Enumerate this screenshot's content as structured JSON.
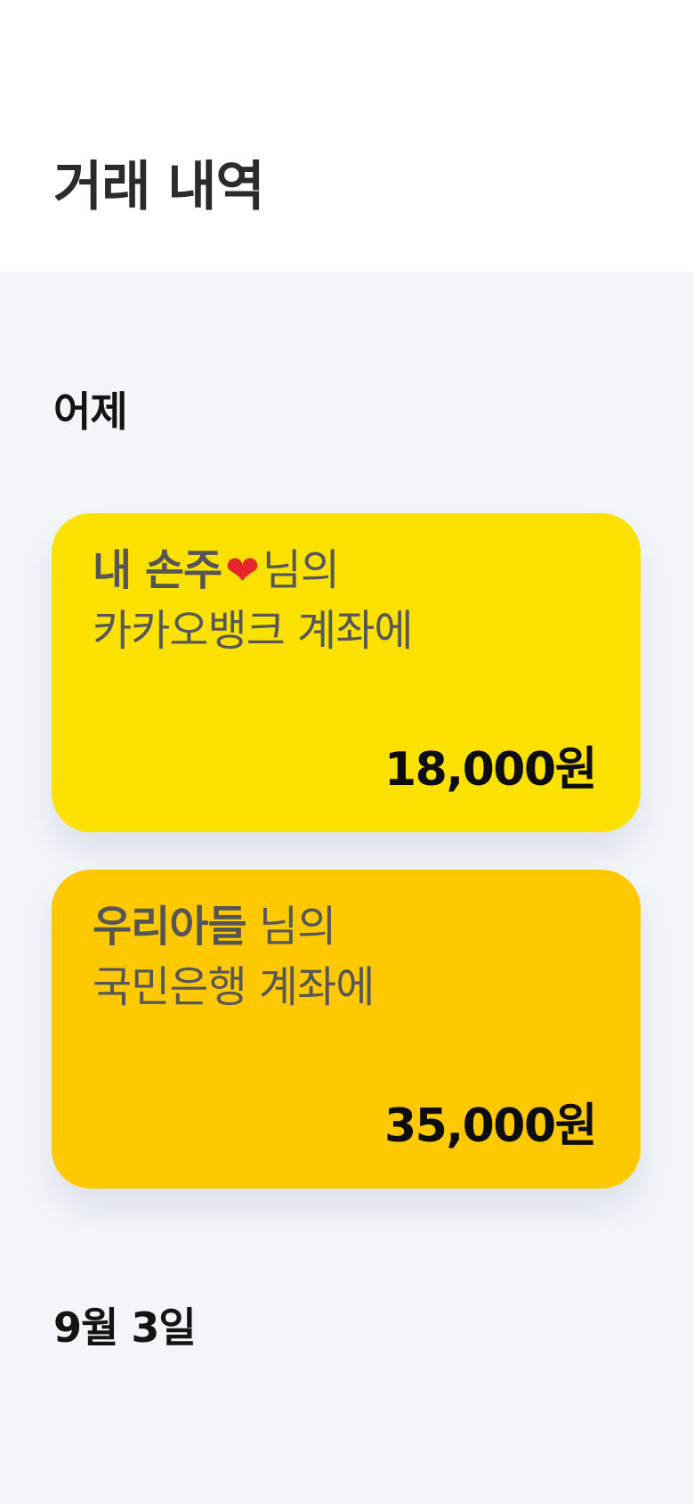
{
  "header": {
    "title": "거래 내역"
  },
  "sections": [
    {
      "label": "어제",
      "transactions": [
        {
          "recipient_name": "내 손주",
          "name_icon": "heart-icon",
          "name_icon_glyph": "❤",
          "suffix": "님의",
          "bank_line": "카카오뱅크 계좌에",
          "amount": "18,000원",
          "card_color": "#FAE100"
        },
        {
          "recipient_name": "우리아들",
          "suffix": "님의",
          "bank_line": "국민은행 계좌에",
          "amount": "35,000원",
          "card_color": "#FEC901"
        }
      ]
    },
    {
      "label": "9월 3일"
    }
  ],
  "colors": {
    "background": "#F2F5FA",
    "header_background": "#FFFFFF"
  }
}
